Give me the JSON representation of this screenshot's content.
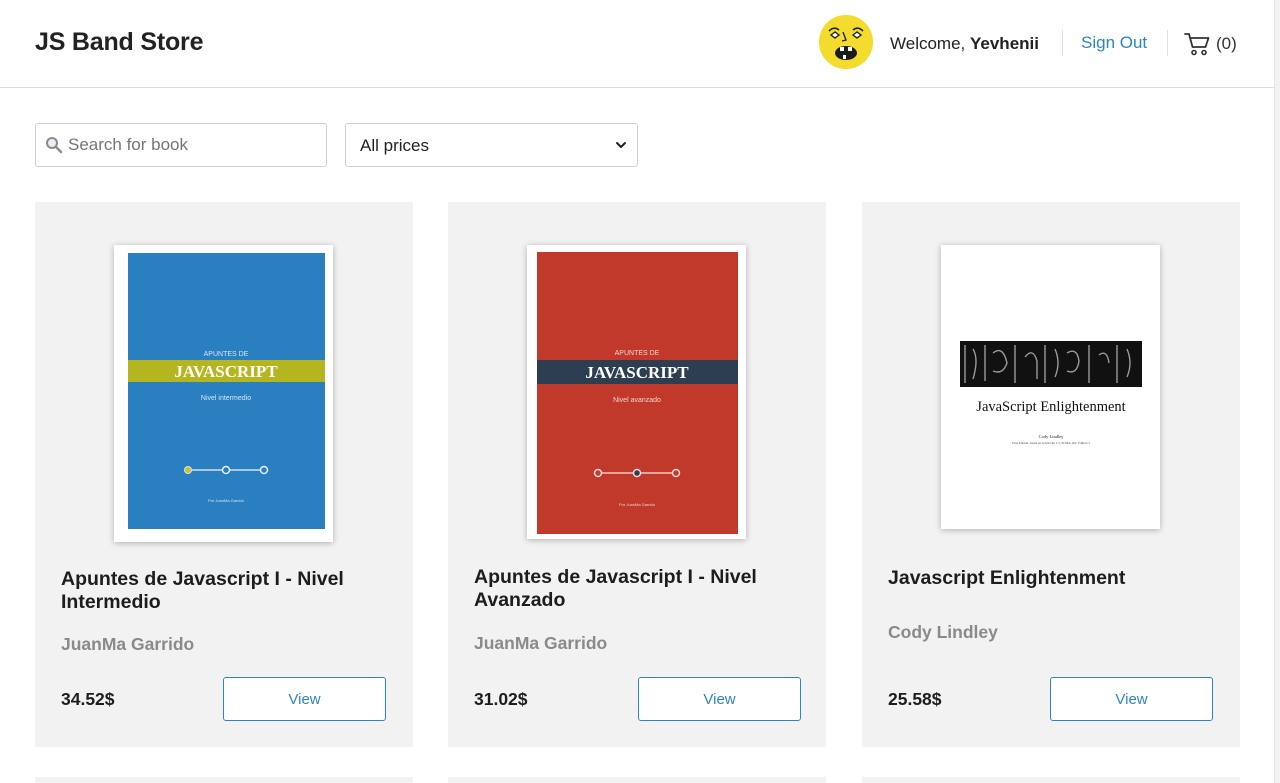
{
  "header": {
    "brand": "JS Band Store",
    "welcome_prefix": "Welcome, ",
    "username": "Yevhenii",
    "sign_out": "Sign Out",
    "cart_count": "(0)"
  },
  "filters": {
    "search_placeholder": "Search for book",
    "search_value": "",
    "price_selected": "All prices"
  },
  "books": [
    {
      "title": "Apuntes de Javascript I - Nivel Intermedio",
      "author": "JuanMa Garrido",
      "price": "34.52$",
      "view_label": "View",
      "cover": {
        "pre": "APUNTES DE",
        "main": "JAVASCRIPT",
        "sub": "Nivel intermedio",
        "by": "Por JuanMa Garrido"
      }
    },
    {
      "title": "Apuntes de Javascript I - Nivel Avanzado",
      "author": "JuanMa Garrido",
      "price": "31.02$",
      "view_label": "View",
      "cover": {
        "pre": "APUNTES DE",
        "main": "JAVASCRIPT",
        "sub": "Nivel avanzado",
        "by": "Por JuanMa Garrido"
      }
    },
    {
      "title": "Javascript Enlightenment",
      "author": "Cody Lindley",
      "price": "25.58$",
      "view_label": "View",
      "cover": {
        "main": "JavaScript Enlightenment",
        "by": "Cody Lindley",
        "edition": "First Edition, based on JavaScript 1.5, ECMA-262, Edition 3"
      }
    }
  ],
  "colors": {
    "accent": "#2e86c1",
    "card_bg": "#f2f2f2",
    "cover_blue": "#2a7fc0",
    "cover_red": "#c0392b",
    "band_olive": "#b5b51f",
    "band_navy": "#2c3e50"
  },
  "icons": {
    "search": "magnifier-icon",
    "cart": "cart-icon",
    "select": "chevron-down-icon",
    "avatar": "avatar-face-icon"
  }
}
